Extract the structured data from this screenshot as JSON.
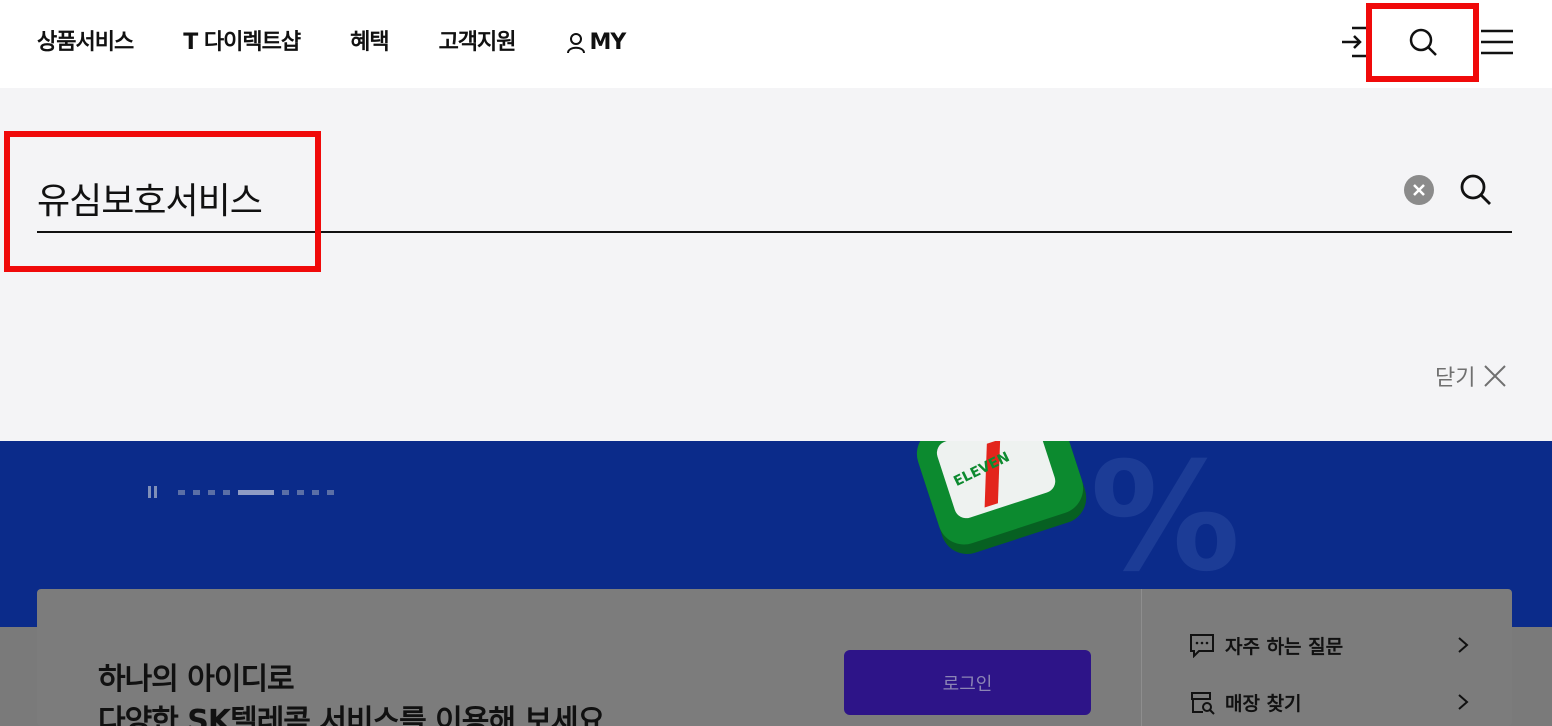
{
  "header": {
    "nav": [
      {
        "label": "상품서비스"
      },
      {
        "label": "T 다이렉트샵"
      },
      {
        "label": "혜택"
      },
      {
        "label": "고객지원"
      },
      {
        "label": "MY"
      }
    ],
    "icons": [
      "login-icon",
      "search-icon",
      "menu-icon"
    ]
  },
  "search": {
    "query": "유심보호서비스",
    "close_label": "닫기"
  },
  "banner": {
    "pager_total": 9,
    "pager_active_index": 4,
    "brand_text": "ELEVEN",
    "percent_text": "%"
  },
  "login_card": {
    "title_line1": "하나의 아이디로",
    "title_line2": "다양한 SK텔레콤 서비스를 이용해 보세요",
    "login_button": "로그인",
    "quick_links": [
      {
        "label": "자주 하는 질문"
      },
      {
        "label": "매장 찾기"
      }
    ]
  },
  "colors": {
    "highlight": "#f00a0a",
    "banner_bg": "#0b2b8a",
    "search_panel_bg": "#f4f4f6",
    "login_button_bg": "#2d1488"
  }
}
